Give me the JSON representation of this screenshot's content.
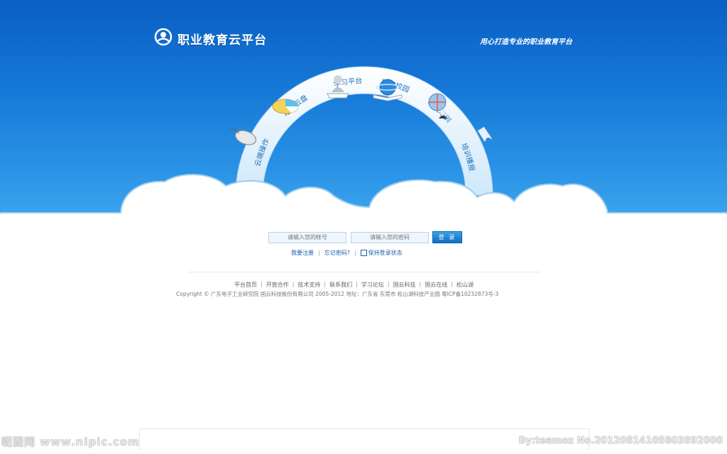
{
  "header": {
    "logo_text": "职业教育云平台",
    "slogan": "用心打造专业的职业教育平台"
  },
  "arc_menu": [
    {
      "label": "云端操作",
      "icon": "mouse-icon"
    },
    {
      "label": "培训云盘",
      "icon": "pie-chart-icon"
    },
    {
      "label": "学习平台",
      "icon": "user-desk-icon"
    },
    {
      "label": "数字校园",
      "icon": "globe-book-icon"
    },
    {
      "label": "城域培训",
      "icon": "globe-person-icon"
    },
    {
      "label": "培训播报",
      "icon": "speaker-icon"
    }
  ],
  "login": {
    "account_placeholder": "请输入您的帐号",
    "password_placeholder": "请输入您的密码",
    "submit_label": "登 录",
    "register_link": "我要注册",
    "forgot_link": "忘记密码?",
    "remember_label": "保持登录状态"
  },
  "footer_nav": [
    "平台首页",
    "开放合作",
    "技术支持",
    "联系我们",
    "学习论坛",
    "国云科技",
    "国云在线",
    "松山湖"
  ],
  "copyright": "Copyright © 广东电子工业研究院 国云科技股份有限公司 2005-2012  地址：广东省 东莞市 松山湖科技产业园   粤ICP备10232873号-3",
  "watermark_left": "昵图网 www.nipic.com",
  "watermark_right": "By:teamoz No.20120814105803892000",
  "colors": {
    "sky_top": "#0a5fc4",
    "sky_bottom": "#3aa3ec",
    "arc_text": "#1e6fb6",
    "link": "#1a5fa8"
  }
}
